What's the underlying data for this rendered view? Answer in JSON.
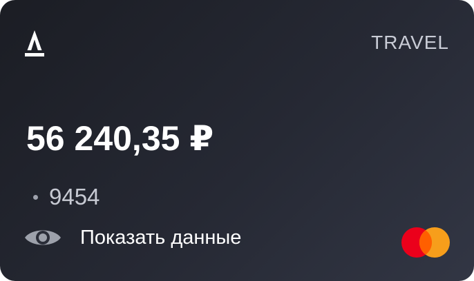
{
  "card": {
    "bank_logo": "alfa-bank-logo",
    "category": "TRAVEL",
    "balance": "56 240,35 ₽",
    "card_mask": "9454",
    "show_data_label": "Показать данные",
    "eye_icon": "eye-icon",
    "payment_system_logo": "mastercard-logo"
  },
  "colors": {
    "background_start": "#1b1d24",
    "background_end": "#323644",
    "mastercard_red": "#eb001b",
    "mastercard_orange": "#f79e1b",
    "mastercard_overlap": "#ff5f00"
  }
}
